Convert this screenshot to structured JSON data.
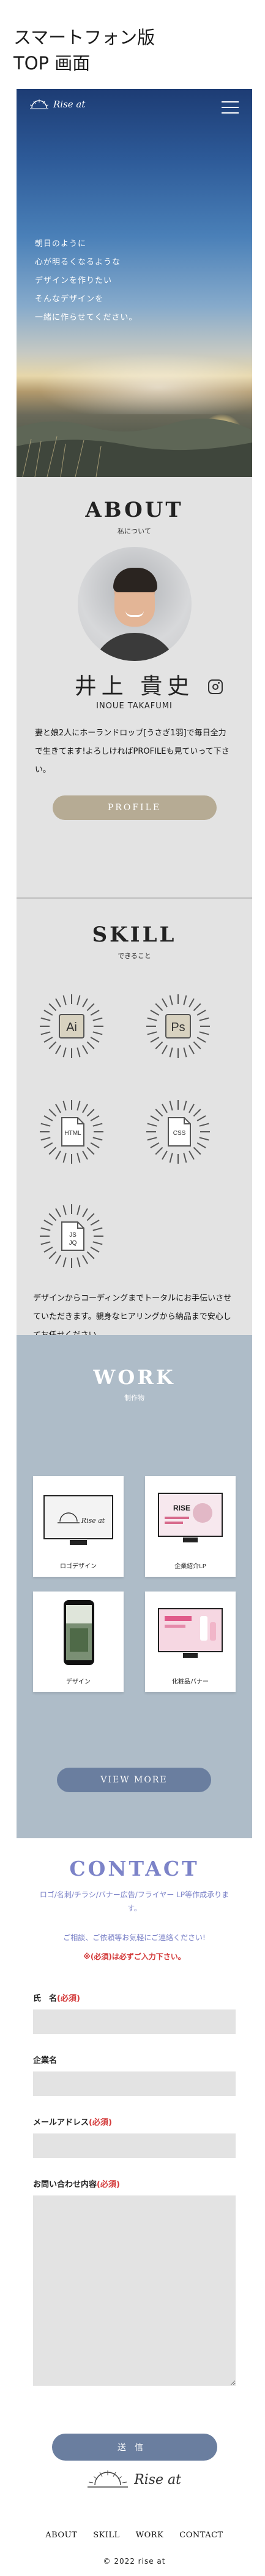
{
  "caption": {
    "line1": "スマートフォン版",
    "line2": "TOP 画面"
  },
  "brand": {
    "name": "Rise at"
  },
  "hero": {
    "lines": [
      "朝日のように",
      "心が明るくなるような",
      "デザインを作りたい",
      "そんなデザインを",
      "一緒に作らせてください。"
    ]
  },
  "about": {
    "title": "ABOUT",
    "subtitle": "私について",
    "name": "井上 貴史",
    "name_en": "INOUE TAKAFUMI",
    "text": "妻と娘2人にホーランドロップ[うさぎ1羽]で毎日全力で生きてます!よろしければPROFILEも見ていって下さい。",
    "button": "PROFILE",
    "icon": "instagram-icon"
  },
  "skill": {
    "title": "SKILL",
    "subtitle": "できること",
    "items": [
      {
        "label": "Ai",
        "icon": "illustrator-icon"
      },
      {
        "label": "Ps",
        "icon": "photoshop-icon"
      },
      {
        "label": "HTML",
        "icon": "html-file-icon"
      },
      {
        "label": "CSS",
        "icon": "css-file-icon"
      },
      {
        "label": "JS",
        "label2": "JQ",
        "icon": "js-jquery-file-icon"
      }
    ],
    "description": "デザインからコーディングまでトータルにお手伝いさせていただきます。親身なヒアリングから納品まで安心してお任せください。"
  },
  "work": {
    "title": "WORK",
    "subtitle": "制作物",
    "items": [
      {
        "caption": "ロゴデザイン",
        "thumb_text": "Rise at"
      },
      {
        "caption": "企業紹介LP",
        "thumb_text": "RISE"
      },
      {
        "caption": "デザイン",
        "thumb_text": ""
      },
      {
        "caption": "化粧品バナー",
        "thumb_text": ""
      }
    ],
    "button": "VIEW MORE"
  },
  "contact": {
    "title": "CONTACT",
    "info": "ロゴ/名刺/チラシ/バナー広告/フライヤー LP等作成承ります。",
    "note": "ご相談、ご依頼等お気軽にご連絡ください!",
    "req_note": "※(必須)は必ずご入力下さい。",
    "required_mark": "(必須)",
    "fields": [
      {
        "label": "氏　名",
        "required": true
      },
      {
        "label": "企業名",
        "required": false
      },
      {
        "label": "メールアドレス",
        "required": true
      },
      {
        "label": "お問い合わせ内容",
        "required": true
      }
    ],
    "submit": "送信"
  },
  "footer": {
    "nav": [
      "ABOUT",
      "SKILL",
      "WORK",
      "CONTACT"
    ],
    "copyright": "© 2022 rise at"
  },
  "colors": {
    "accent_blue": "#6a7e9f",
    "accent_gold": "#b6ab94",
    "contact_purple": "#7c83c8",
    "required_red": "#d43c3c",
    "work_bg": "#aebcc8"
  }
}
